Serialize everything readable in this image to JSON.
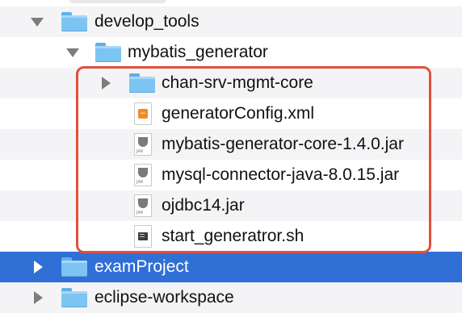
{
  "tree": {
    "rows": [
      {
        "label": "develop_tools",
        "type": "folder",
        "expanded": true
      },
      {
        "label": "mybatis_generator",
        "type": "folder",
        "expanded": true
      },
      {
        "label": "chan-srv-mgmt-core",
        "type": "folder",
        "expanded": false
      },
      {
        "label": "generatorConfig.xml",
        "type": "xml-file"
      },
      {
        "label": "mybatis-generator-core-1.4.0.jar",
        "type": "jar-file"
      },
      {
        "label": "mysql-connector-java-8.0.15.jar",
        "type": "jar-file"
      },
      {
        "label": "ojdbc14.jar",
        "type": "jar-file"
      },
      {
        "label": "start_generatror.sh",
        "type": "shell-file"
      },
      {
        "label": "examProject",
        "type": "folder",
        "expanded": false,
        "selected": true
      },
      {
        "label": "eclipse-workspace",
        "type": "folder",
        "expanded": false
      }
    ]
  },
  "colors": {
    "selection": "#2f6fd6",
    "highlight_border": "#e0503a",
    "folder": "#7cc4f2",
    "disclosure": "#7d7d7d"
  },
  "icons": {
    "folder": "folder-icon",
    "xml": "xml-file-icon",
    "jar": "jar-file-icon",
    "shell": "shell-script-icon"
  }
}
